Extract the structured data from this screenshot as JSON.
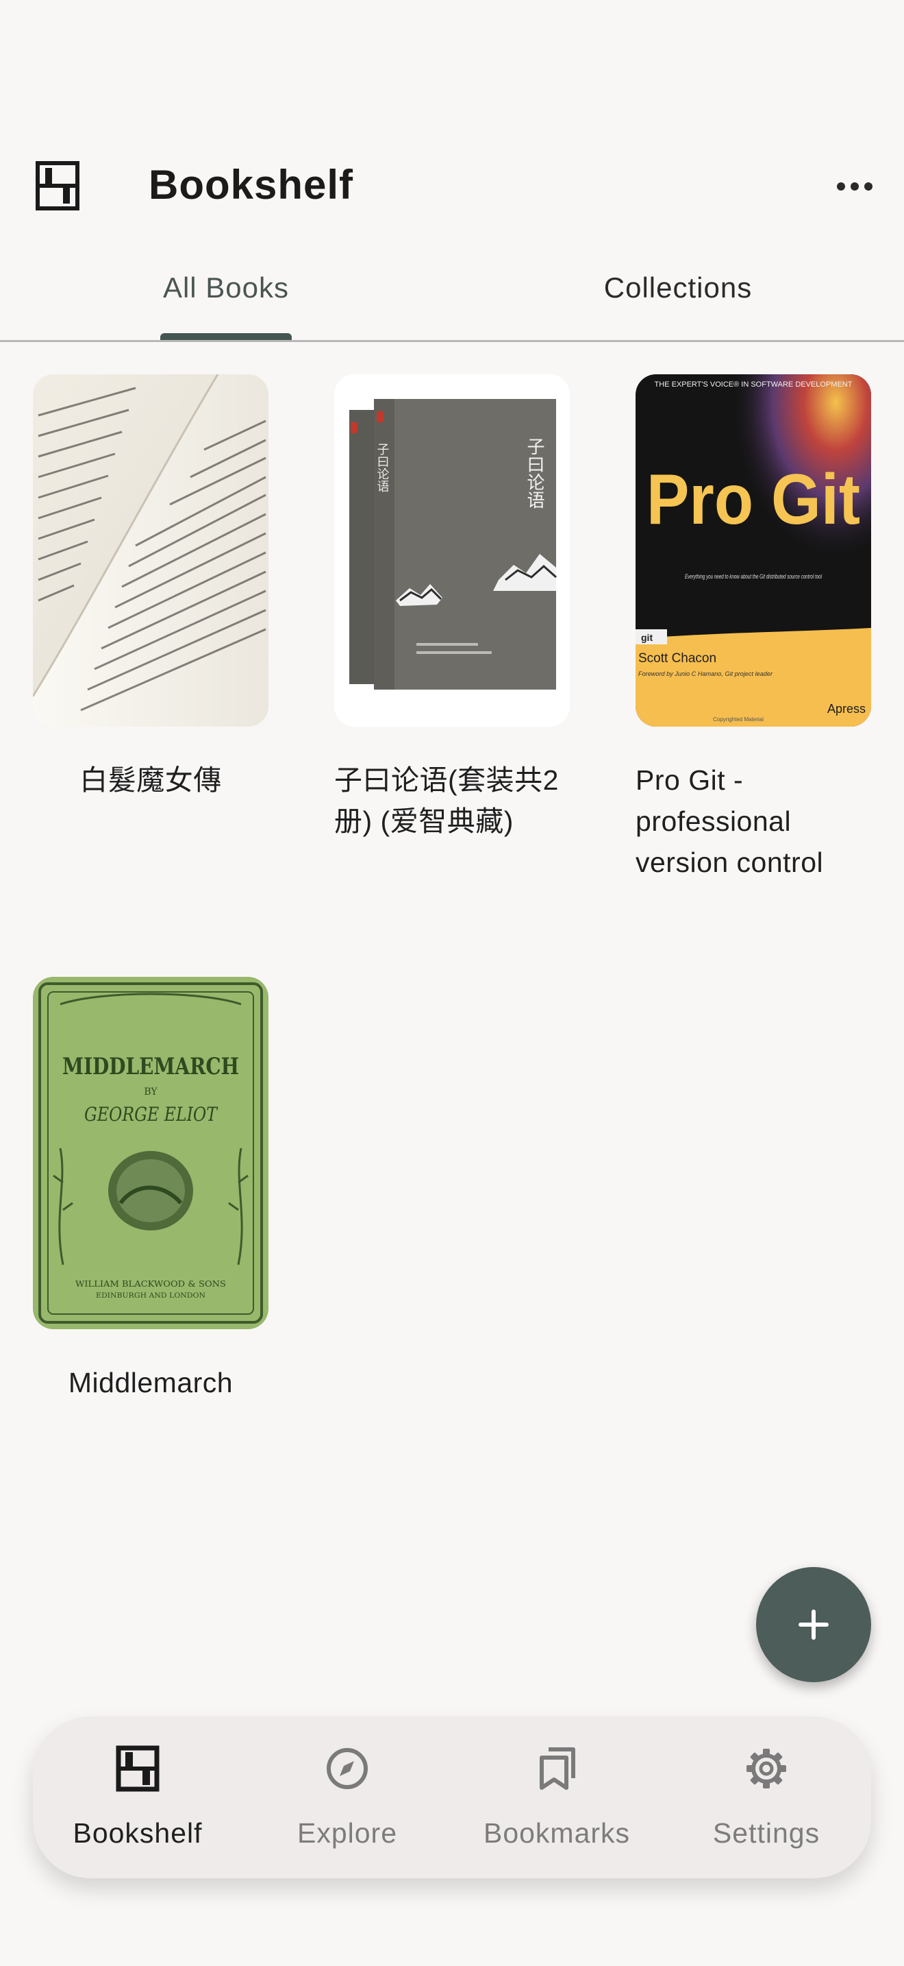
{
  "app_bar": {
    "title": "Bookshelf",
    "logo_icon": "bookshelf-icon",
    "more_icon": "more-horiz-icon"
  },
  "tabs": [
    {
      "label": "All Books",
      "selected": true
    },
    {
      "label": "Collections",
      "selected": false
    }
  ],
  "books": [
    {
      "title": "白髮魔女傳",
      "cover": "open-book-photo"
    },
    {
      "title": "子曰论语(套装共2册) (爱智典藏)",
      "cover": "grey-box-set",
      "cover_text": {
        "title": "子曰论语",
        "spine_title": "子曰论语"
      }
    },
    {
      "title": "Pro Git - professional version control",
      "cover": "pro-git",
      "cover_text": {
        "series": "THE EXPERT'S VOICE® IN SOFTWARE DEVELOPMENT",
        "title": "Pro Git",
        "tagline": "Everything you need to know about the Git distributed source control tool",
        "badge": "git",
        "author": "Scott Chacon",
        "foreword": "Foreword by Junio C Hamano, Git project leader",
        "publisher": "Apress",
        "footer": "Copyrighted Material"
      }
    },
    {
      "title": "Middlemarch",
      "cover": "green-ornate",
      "cover_text": {
        "title": "MIDDLEMARCH",
        "by": "BY",
        "author": "GEORGE ELIOT",
        "publisher": "WILLIAM BLACKWOOD & SONS",
        "place": "EDINBURGH AND LONDON"
      }
    }
  ],
  "fab": {
    "icon": "plus-icon"
  },
  "nav": [
    {
      "label": "Bookshelf",
      "icon": "bookshelf-icon",
      "active": true
    },
    {
      "label": "Explore",
      "icon": "compass-icon",
      "active": false
    },
    {
      "label": "Bookmarks",
      "icon": "bookmarks-icon",
      "active": false
    },
    {
      "label": "Settings",
      "icon": "gear-icon",
      "active": false
    }
  ],
  "colors": {
    "background": "#f9f7f6",
    "accent": "#455652",
    "fab": "#4d5d59",
    "nav_background": "#efebea"
  }
}
